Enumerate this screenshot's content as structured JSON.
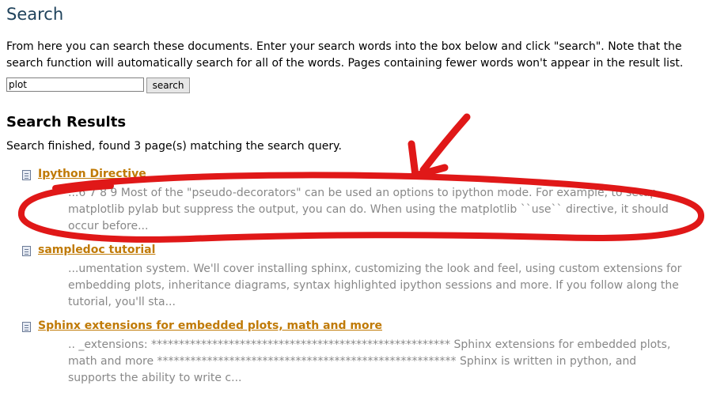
{
  "page": {
    "title": "Search",
    "intro": "From here you can search these documents. Enter your search words into the box below and click \"search\". Note that the search function will automatically search for all of the words. Pages containing fewer words won't appear in the result list."
  },
  "search": {
    "value": "plot",
    "button_label": "search"
  },
  "results_section": {
    "heading": "Search Results",
    "status": "Search finished, found 3 page(s) matching the search query."
  },
  "results": [
    {
      "title": "Ipython Directive",
      "summary": "...6 7 8 9 Most of the \"pseudo-decorators\" can be used an options to ipython mode. For example, to setup matplotlib pylab but suppress the output, you can do. When using the matplotlib ``use`` directive, it should occur before..."
    },
    {
      "title": "sampledoc tutorial",
      "summary": "...umentation system. We'll cover installing sphinx, customizing the look and feel, using custom extensions for embedding plots, inheritance diagrams, syntax highlighted ipython sessions and more. If you follow along the tutorial, you'll sta..."
    },
    {
      "title": "Sphinx extensions for embedded plots, math and more",
      "summary": ".. _extensions: ****************************************************** Sphinx extensions for embedded plots, math and more ****************************************************** Sphinx is written in python, and supports the ability to write c..."
    }
  ],
  "colors": {
    "heading": "#20435c",
    "link": "#c07a06",
    "summary_text": "#888888",
    "annotation_red": "#e01818"
  },
  "icons": {
    "result_icon": "document-icon"
  }
}
